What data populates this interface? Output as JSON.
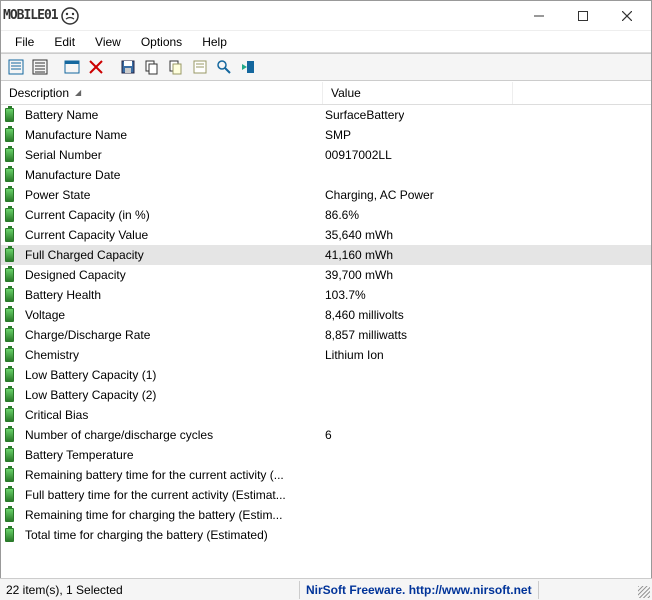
{
  "title": "MOBILE01",
  "menu": {
    "file": "File",
    "edit": "Edit",
    "view": "View",
    "options": "Options",
    "help": "Help"
  },
  "columns": {
    "description": "Description",
    "value": "Value"
  },
  "rows": [
    {
      "desc": "Battery Name",
      "val": "SurfaceBattery",
      "sel": false
    },
    {
      "desc": "Manufacture Name",
      "val": "SMP",
      "sel": false
    },
    {
      "desc": "Serial Number",
      "val": "00917002LL",
      "sel": false
    },
    {
      "desc": "Manufacture Date",
      "val": "",
      "sel": false
    },
    {
      "desc": "Power State",
      "val": "Charging, AC Power",
      "sel": false
    },
    {
      "desc": "Current Capacity (in %)",
      "val": "86.6%",
      "sel": false
    },
    {
      "desc": "Current Capacity Value",
      "val": "35,640 mWh",
      "sel": false
    },
    {
      "desc": "Full Charged Capacity",
      "val": "41,160 mWh",
      "sel": true
    },
    {
      "desc": "Designed Capacity",
      "val": "39,700 mWh",
      "sel": false
    },
    {
      "desc": "Battery Health",
      "val": "103.7%",
      "sel": false
    },
    {
      "desc": "Voltage",
      "val": "8,460 millivolts",
      "sel": false
    },
    {
      "desc": "Charge/Discharge Rate",
      "val": "8,857 milliwatts",
      "sel": false
    },
    {
      "desc": "Chemistry",
      "val": "Lithium Ion",
      "sel": false
    },
    {
      "desc": "Low Battery Capacity (1)",
      "val": "",
      "sel": false
    },
    {
      "desc": "Low Battery Capacity (2)",
      "val": "",
      "sel": false
    },
    {
      "desc": "Critical Bias",
      "val": "",
      "sel": false
    },
    {
      "desc": "Number of charge/discharge cycles",
      "val": "6",
      "sel": false
    },
    {
      "desc": "Battery Temperature",
      "val": "",
      "sel": false
    },
    {
      "desc": "Remaining battery time for the current activity (...",
      "val": "",
      "sel": false
    },
    {
      "desc": "Full battery time for the current activity (Estimat...",
      "val": "",
      "sel": false
    },
    {
      "desc": "Remaining time for charging the battery (Estim...",
      "val": "",
      "sel": false
    },
    {
      "desc": "Total  time for charging the battery (Estimated)",
      "val": "",
      "sel": false
    }
  ],
  "status": {
    "left": "22 item(s), 1 Selected",
    "right": "NirSoft Freeware.  http://www.nirsoft.net"
  }
}
